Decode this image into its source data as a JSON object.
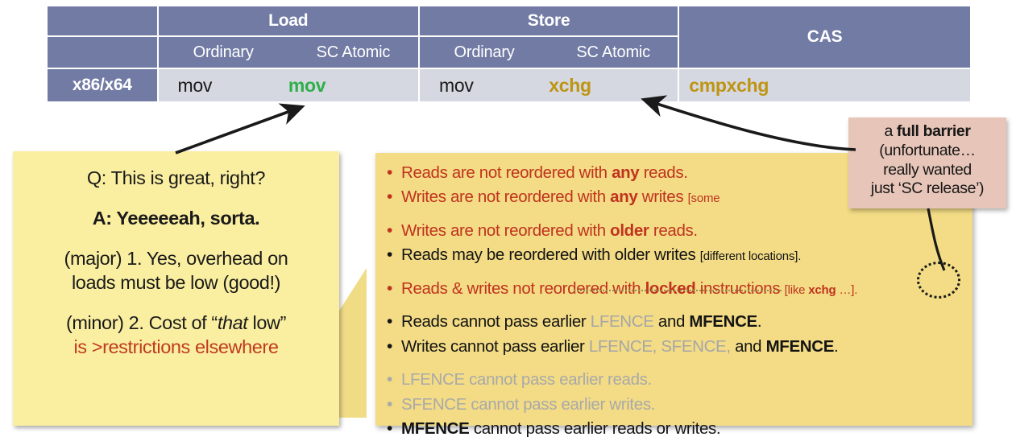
{
  "table": {
    "corner_label": "",
    "groups": [
      {
        "name": "Load",
        "subcolumns": [
          "Ordinary",
          "SC Atomic"
        ]
      },
      {
        "name": "Store",
        "subcolumns": [
          "Ordinary",
          "SC Atomic"
        ]
      },
      {
        "name": "CAS",
        "subcolumns": []
      }
    ],
    "rows": [
      {
        "label": "x86/x64",
        "load_ordinary": "mov",
        "load_sc_atomic": "mov",
        "store_ordinary": "mov",
        "store_sc_atomic": "xchg",
        "cas": "cmpxchg"
      }
    ],
    "colors": {
      "header_bg": "#717BA4",
      "row_bg": "#D5D8E0",
      "load_sc_atomic_text": "#2FAF4A",
      "store_sc_atomic_text": "#BE9413",
      "cas_text": "#BE9413"
    }
  },
  "left_note": {
    "question": "Q: This is great, right?",
    "answer": "A: Yeeeeeah, sorta.",
    "point1_prefix": "(major) 1. Yes, overhead on",
    "point1_suffix": "loads must be low (good!)",
    "point2_prefix": "(minor) 2. Cost of “",
    "point2_italic": "that",
    "point2_mid": "” low”",
    "point2_tail": " low”",
    "point2_red": "is >restrictions elsewhere",
    "bg_color": "#FAEFA0"
  },
  "memory_model_note": {
    "bg_color": "#F3DC85",
    "bullets": [
      {
        "id": "b1",
        "color": "red",
        "parts": [
          {
            "t": "Reads are not reordered with "
          },
          {
            "t": "any",
            "bold": true
          },
          {
            "t": " reads."
          }
        ]
      },
      {
        "id": "b2",
        "color": "red",
        "parts": [
          {
            "t": "Writes are not reordered with "
          },
          {
            "t": "any",
            "bold": true
          },
          {
            "t": " writes "
          },
          {
            "t": "[some",
            "small": true
          }
        ]
      },
      {
        "id": "spacer1",
        "spacer": true
      },
      {
        "id": "b3",
        "color": "red",
        "parts": [
          {
            "t": "Writes are not reordered with "
          },
          {
            "t": "older",
            "bold": true
          },
          {
            "t": " reads."
          }
        ]
      },
      {
        "id": "b4",
        "color": "dark",
        "parts": [
          {
            "t": "Reads may be reordered with older writes "
          },
          {
            "t": "[different locations].",
            "small": true
          }
        ]
      },
      {
        "id": "spacer2",
        "spacer": true
      },
      {
        "id": "b5",
        "color": "red",
        "parts": [
          {
            "t": "Reads & writes not reordered with "
          },
          {
            "t": "locked",
            "bold": true
          },
          {
            "t": " instructions "
          },
          {
            "t": "[like ",
            "small": true
          },
          {
            "t": "xchg",
            "small": true,
            "bold": true
          },
          {
            "t": " …].",
            "small": true
          }
        ]
      },
      {
        "id": "spacer3",
        "spacer": true
      },
      {
        "id": "b6",
        "color": "dark",
        "parts": [
          {
            "t": "Reads cannot pass earlier "
          },
          {
            "t": "LFENCE",
            "fence": true
          },
          {
            "t": " and "
          },
          {
            "t": "MFENCE",
            "bold": true
          },
          {
            "t": "."
          }
        ]
      },
      {
        "id": "b7",
        "color": "dark",
        "parts": [
          {
            "t": "Writes cannot pass earlier "
          },
          {
            "t": "LFENCE, SFENCE, ",
            "fence": true
          },
          {
            "t": "and "
          },
          {
            "t": "MFENCE",
            "bold": true
          },
          {
            "t": "."
          }
        ]
      },
      {
        "id": "spacer4",
        "spacer": true
      },
      {
        "id": "b8",
        "color": "grey",
        "parts": [
          {
            "t": "LFENCE cannot pass earlier reads."
          }
        ]
      },
      {
        "id": "b9",
        "color": "grey",
        "parts": [
          {
            "t": "SFENCE cannot pass earlier writes."
          }
        ]
      },
      {
        "id": "b10",
        "color": "dark",
        "parts": [
          {
            "t": "MFENCE",
            "bold": true
          },
          {
            "t": " cannot pass earlier reads or writes."
          }
        ]
      }
    ]
  },
  "pink_callout": {
    "line1_prefix": "a ",
    "line1_bold": "full barrier",
    "line2": "(unfortunate…",
    "line3": "really wanted",
    "line4": "just ‘SC release’)",
    "bg_color": "#E7C5B8"
  },
  "annotations": {
    "arrow_to_load_sc_atomic": "arrow-to-mov",
    "arrow_to_store_sc_atomic": "arrow-to-xchg",
    "circle_on_xchg": "dotted-circle-xchg",
    "leader_pink_to_xchg": "leader-line"
  }
}
